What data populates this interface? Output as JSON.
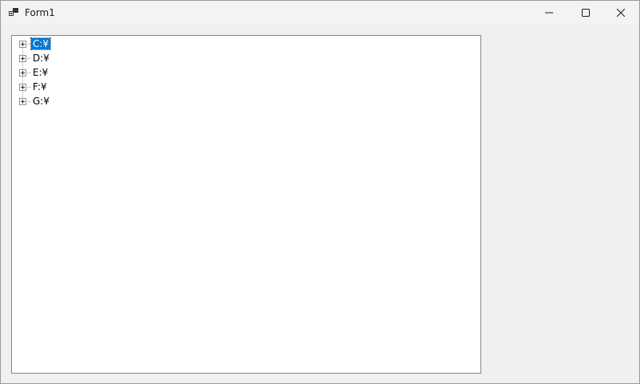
{
  "window": {
    "title": "Form1",
    "icon": "app-form-icon",
    "controls": {
      "minimize": "minimize-icon",
      "maximize": "maximize-icon",
      "close": "close-icon"
    }
  },
  "tree": {
    "selected_index": 0,
    "expander_icon": "plus-expander-icon",
    "nodes": [
      {
        "label": "C:¥"
      },
      {
        "label": "D:¥"
      },
      {
        "label": "E:¥"
      },
      {
        "label": "F:¥"
      },
      {
        "label": "G:¥"
      }
    ]
  },
  "colors": {
    "selection": "#0078d7",
    "window_bg": "#f0f0f0",
    "tree_bg": "#ffffff"
  }
}
